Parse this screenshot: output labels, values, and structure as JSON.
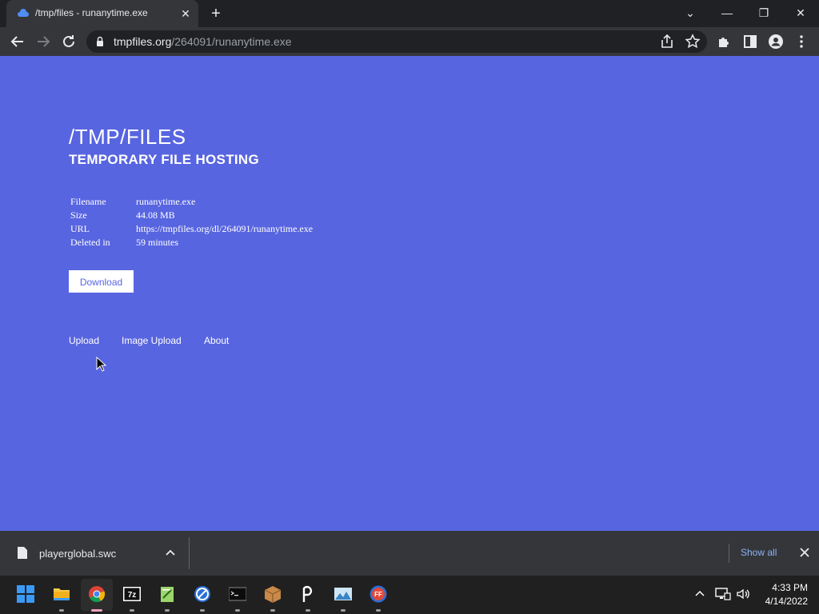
{
  "browser": {
    "tab_title": "/tmp/files - runanytime.exe",
    "url_host": "tmpfiles.org",
    "url_path": "/264091/runanytime.exe"
  },
  "page": {
    "title": "/TMP/FILES",
    "subtitle": "TEMPORARY FILE HOSTING",
    "info": [
      {
        "key": "Filename",
        "value": "runanytime.exe"
      },
      {
        "key": "Size",
        "value": "44.08 MB"
      },
      {
        "key": "URL",
        "value": "https://tmpfiles.org/dl/264091/runanytime.exe"
      },
      {
        "key": "Deleted in",
        "value": "59 minutes"
      }
    ],
    "download_label": "Download",
    "nav": {
      "upload": "Upload",
      "image_upload": "Image Upload",
      "about": "About"
    }
  },
  "shelf": {
    "filename": "playerglobal.swc",
    "show_all": "Show all"
  },
  "taskbar": {
    "time": "4:33 PM",
    "date": "4/14/2022",
    "apps": [
      "start-icon",
      "file-explorer-icon",
      "chrome-icon",
      "7zip-icon",
      "notepadpp-icon",
      "globe-app-icon",
      "terminal-icon",
      "package-icon",
      "pen-app-icon",
      "image-app-icon",
      "ffdec-icon"
    ]
  },
  "colors": {
    "page_bg": "#5865e0",
    "shelf_link": "#8ab4f8"
  }
}
